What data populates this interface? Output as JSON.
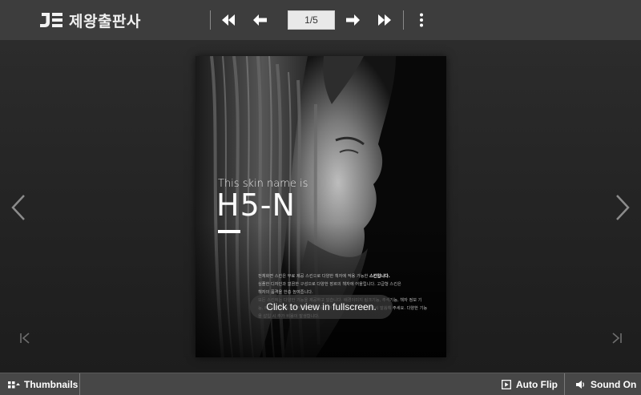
{
  "brand": {
    "name": "제왕출판사",
    "mark": "JE"
  },
  "toolbar": {
    "page_indicator": "1/5",
    "first_page": "first-page",
    "previous_page": "previous-page",
    "next_page": "next-page",
    "last_page": "last-page",
    "more": "more-options"
  },
  "book": {
    "cover": {
      "skin_label": "This skin name is",
      "skin_name": "H5-N",
      "paragraphs": [
        "전체화면 스킨은 무료 제공 스킨으로 다양한 책자에 적용 가능한 스킨입니다.",
        "심플한 디자인과 깔끔한 구성으로 다양한 장르의 책자에 어울립니다. 고급형 스킨은",
        "책자의 품격을 한층 높여줍니다.",
        "모든 스킨에는 다양한 기능을 제공하고 있습니다. 배경이미지 링크기능, 추석기능, 책자 정보 기",
        "능, MP3삽입기능, PDF업로드기능 등 원하시는 기능이 있다면 상담시 말씀해 주세요. 다양한 기능",
        "을 삽입 시 추가 비용이 발생합니다."
      ],
      "paragraph_highlight": "스킨입니다."
    },
    "fullscreen_hint": "Click to view in fullscreen."
  },
  "bottom": {
    "thumbnails": "Thumbnails",
    "auto_flip": "Auto Flip",
    "sound": "Sound On"
  },
  "colors": {
    "toolbar": "#3d3d3d",
    "bottombar": "#474747",
    "stage": "#262626",
    "page_indicator_bg": "#e9e9e9"
  }
}
